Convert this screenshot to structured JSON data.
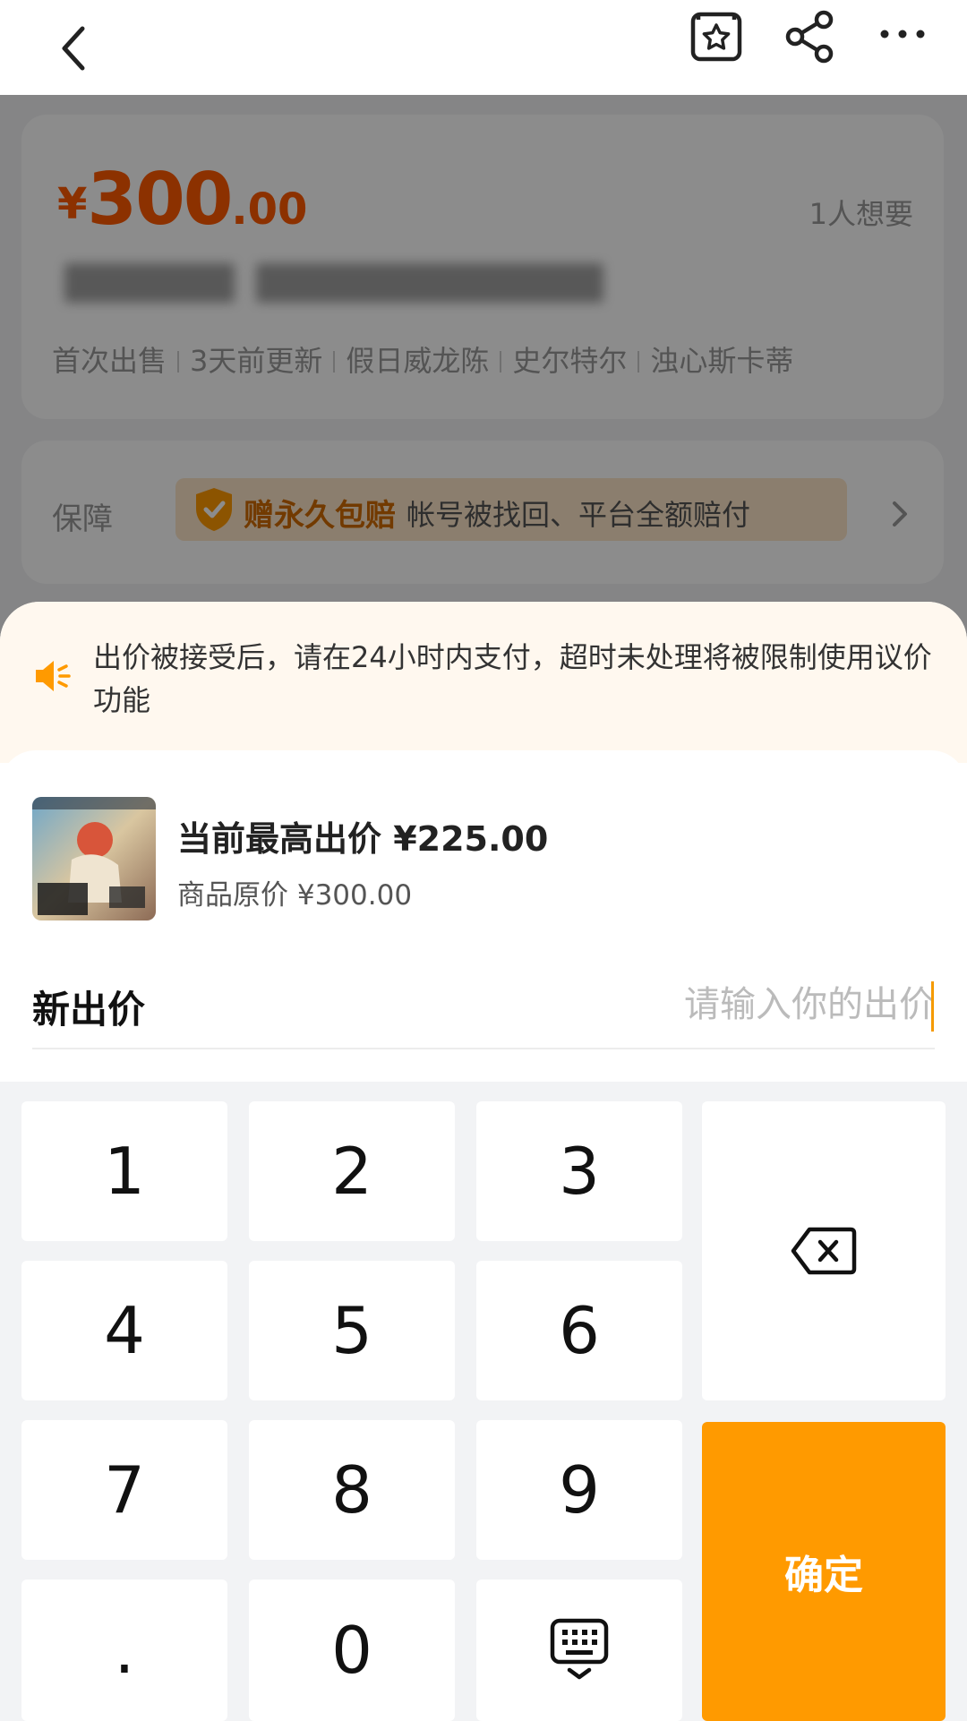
{
  "header": {
    "icons": [
      "back-icon",
      "favorite-star-icon",
      "share-icon",
      "more-icon"
    ]
  },
  "product": {
    "price": {
      "symbol": "¥",
      "integer": "300",
      "decimal": ".00"
    },
    "want_count": "1人想要",
    "tags": [
      "首次出售",
      "3天前更新",
      "假日威龙陈",
      "史尔特尔",
      "浊心斯卡蒂"
    ],
    "guarantee": {
      "label": "保障",
      "highlight": "赠永久包赔",
      "text": "帐号被找回、平台全额赔付"
    }
  },
  "bid_sheet": {
    "notice": "出价被接受后，请在24小时内支付，超时未处理将被限制使用议价功能",
    "current_highest": "当前最高出价 ¥225.00",
    "original_price": "商品原价 ¥300.00",
    "new_bid_label": "新出价",
    "new_bid_placeholder": "请输入你的出价",
    "new_bid_value": ""
  },
  "keypad": {
    "keys": {
      "k1": "1",
      "k2": "2",
      "k3": "3",
      "k4": "4",
      "k5": "5",
      "k6": "6",
      "k7": "7",
      "k8": "8",
      "k9": "9",
      "dot": ".",
      "k0": "0"
    },
    "confirm": "确定",
    "icons": [
      "backspace-icon",
      "keyboard-hide-icon"
    ]
  },
  "colors": {
    "accent": "#ff9a00",
    "price": "#ff5a00",
    "notice_bg": "#fff8ef"
  }
}
